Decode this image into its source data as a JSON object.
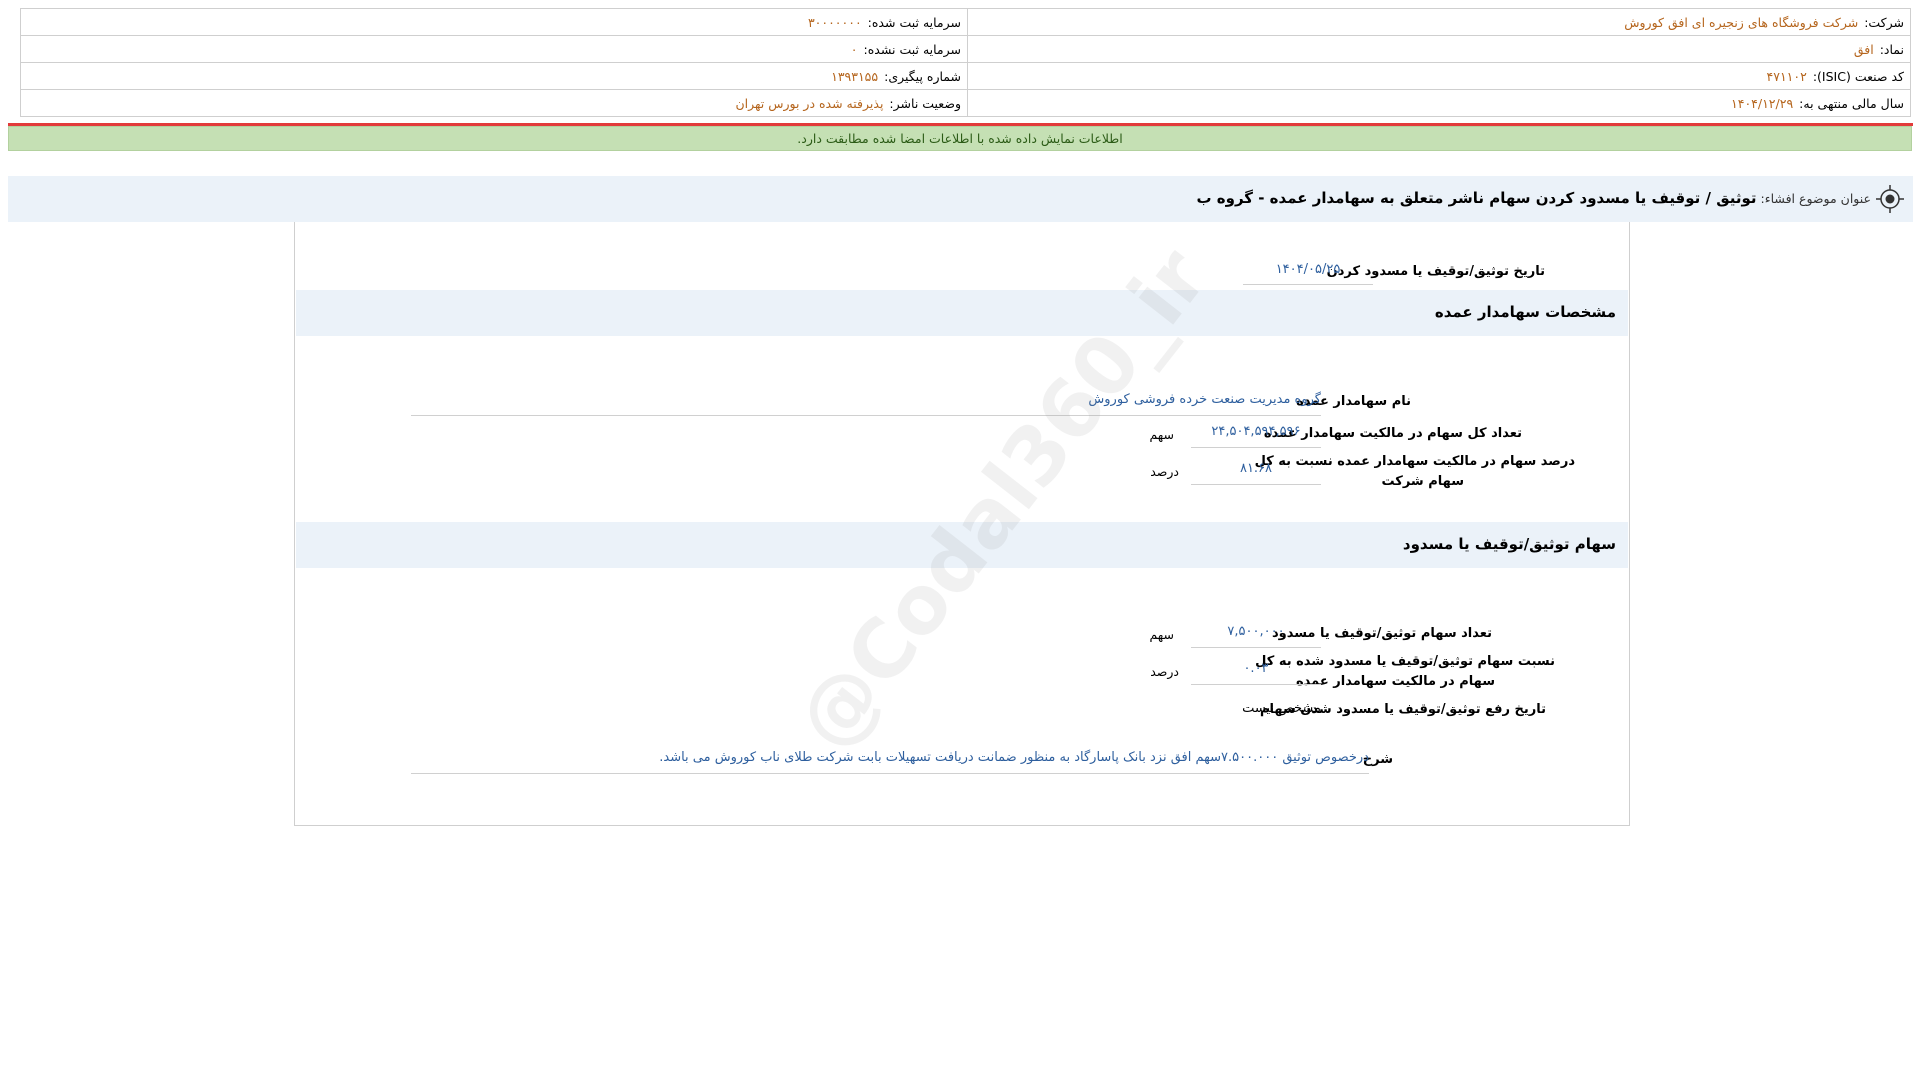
{
  "header": {
    "company_label": "شرکت:",
    "company_value": "شرکت فروشگاه های زنجیره ای افق کوروش",
    "registered_capital_label": "سرمایه ثبت شده:",
    "registered_capital_value": "۳۰۰۰۰۰۰۰",
    "symbol_label": "نماد:",
    "symbol_value": "افق",
    "unregistered_capital_label": "سرمایه ثبت نشده:",
    "unregistered_capital_value": "۰",
    "isic_label": "کد صنعت (ISIC):",
    "isic_value": "۴۷۱۱۰۲",
    "tracking_label": "شماره پیگیری:",
    "tracking_value": "۱۳۹۳۱۵۵",
    "fiscal_year_label": "سال مالی منتهی به:",
    "fiscal_year_value": "۱۴۰۴/۱۲/۲۹",
    "publisher_status_label": "وضعیت ناشر:",
    "publisher_status_value": "پذیرفته شده در بورس تهران"
  },
  "notice": "اطلاعات نمایش داده شده با اطلاعات امضا شده مطابقت دارد.",
  "title": {
    "label": "عنوان موضوع افشاء:",
    "value": "توثیق / توقیف یا مسدود کردن سهام ناشر متعلق به سهامدار عمده - گروه ب"
  },
  "form": {
    "pledge_date_label": "تاریخ توثیق/توقیف یا مسدود کردن",
    "pledge_date_value": "۱۴۰۴/۰۵/۲۵",
    "section1_title": "مشخصات سهامدار عمده",
    "shareholder_name_label": "نام سهامدار عمده",
    "shareholder_name_value": "گروه مدیریت صنعت خرده فروشی کوروش",
    "total_shares_label": "تعداد کل سهام در مالکیت سهامدار عمده",
    "total_shares_value": "۲۴,۵۰۴,۵۹۴,۵۹۶",
    "total_shares_unit": "سهم",
    "ownership_percent_label_1": "درصد سهام در مالکیت سهامدار عمده نسبت به کل",
    "ownership_percent_label_2": "سهام شرکت",
    "ownership_percent_value": "۸۱.۶۸",
    "ownership_percent_unit": "درصد",
    "section2_title": "سهام توثیق/توقیف یا مسدود",
    "pledged_shares_label": "تعداد سهام توثیق/توقیف یا مسدود",
    "pledged_shares_value": "۷,۵۰۰,۰۰۰",
    "pledged_shares_unit": "سهم",
    "pledged_ratio_label_1": "نسبت سهام توثیق/توقیف یا مسدود شده به کل",
    "pledged_ratio_label_2": "سهام در مالکیت سهامدار عمده",
    "pledged_ratio_value": "۰.۰۳",
    "pledged_ratio_unit": "درصد",
    "release_date_label": "تاریخ رفع توثیق/توقیف یا مسدود شدن سهام",
    "release_date_value": "مشخص نیست",
    "description_label": "شرح",
    "description_value": "درخصوص توثیق ۷.۵۰۰.۰۰۰سهم افق نزد بانک پاسارگاد به منظور ضمانت دریافت تسهیلات بابت شرکت طلای ناب کوروش می باشد."
  },
  "watermark": "@Codal360_ir",
  "icons": {
    "title_icon": "target-icon"
  },
  "colors": {
    "value_orange": "#b5651d",
    "value_blue": "#2e5f9e",
    "notice_green": "#c5e0b4",
    "alert_red": "#e23a3a"
  }
}
